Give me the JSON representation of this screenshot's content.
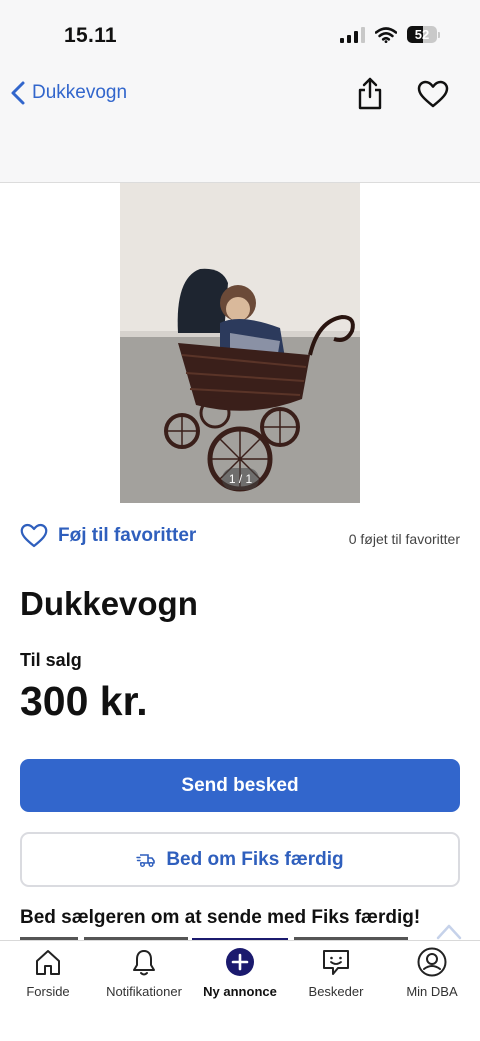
{
  "status_bar": {
    "time": "15.11",
    "battery": "52"
  },
  "nav": {
    "back_label": "Dukkevogn"
  },
  "gallery": {
    "counter": "1 / 1"
  },
  "favorites": {
    "add_label": "Føj til favoritter",
    "count_text": "0 føjet til favoritter"
  },
  "listing": {
    "title": "Dukkevogn",
    "status": "Til salg",
    "price": "300 kr."
  },
  "actions": {
    "send_message": "Send besked",
    "fiks_faerdig": "Bed om Fiks færdig"
  },
  "promo": {
    "heading": "Bed sælgeren om at sende med Fiks færdig!"
  },
  "tabbar": {
    "items": [
      {
        "label": "Forside",
        "icon": "home-icon"
      },
      {
        "label": "Notifikationer",
        "icon": "bell-icon"
      },
      {
        "label": "Ny annonce",
        "icon": "plus-circle-icon"
      },
      {
        "label": "Beskeder",
        "icon": "chat-icon"
      },
      {
        "label": "Min DBA",
        "icon": "profile-icon"
      }
    ]
  },
  "colors": {
    "accent": "#3266cc",
    "link": "#2f5fbd",
    "background": "#ffffff",
    "nav_background": "#f7f7f8",
    "tab_active": "#1b1a6e"
  }
}
